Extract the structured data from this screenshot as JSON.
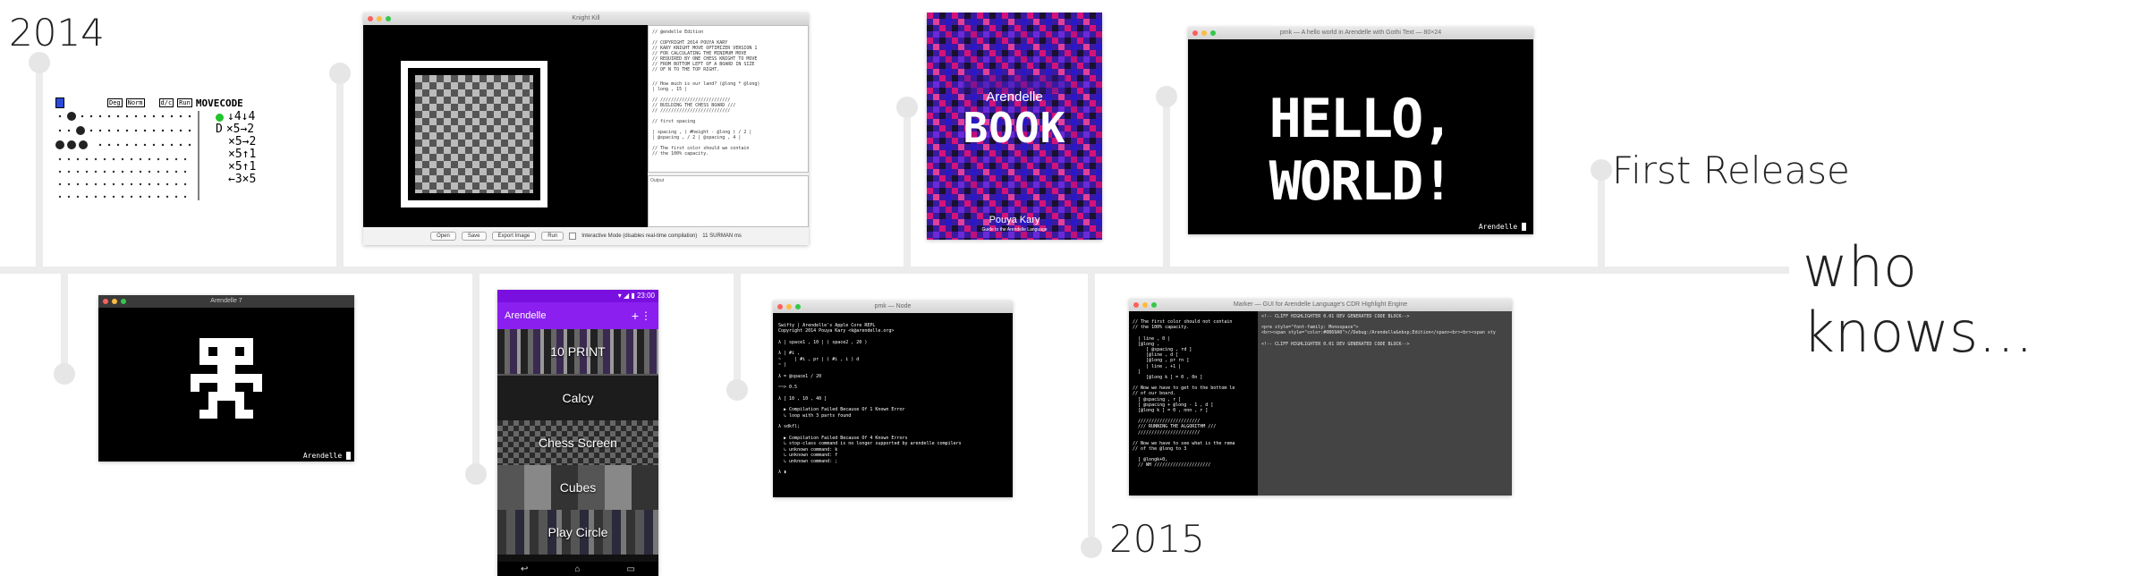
{
  "timeline": {
    "labels": {
      "y2014": "2014",
      "y2015": "2015",
      "first_release": "First Release",
      "who_knows": "who knows…"
    }
  },
  "shots": {
    "movecode": {
      "header": "MOVECODE",
      "btn_deg": "Deg",
      "btn_norm": "Norm",
      "btn_dc": "d/c",
      "btn_run": "Run",
      "cmds": [
        "↓4↓4",
        "×5→2",
        "×5→2",
        "×5↑1",
        "×5↑1",
        "←3×5"
      ],
      "side_letter": "D"
    },
    "knight": {
      "title": "Knight Kill",
      "code_lines": [
        "// @endelle Edition",
        "",
        "// COPYRIGHT 2014 POUYA KARY",
        "// KARY KNIGHT MOVE OPTIMIZER VERSION 1",
        "// FOR CALCULATING THE MINIMUM MOVE",
        "// REQUIRED BY ONE CHESS KNIGHT TO MOVE",
        "// FROM BOTTOM LEFT OF A BOARD IN SIZE",
        "// OF N TO THE TOP RIGHT.",
        "",
        "",
        "// How much is our land? (@long * @long)",
        "  | long , 15 |",
        "",
        "// //////////////////////////",
        "// BUILDING THE CHESS BOARD ///",
        "// //////////////////////////",
        "",
        "// first spacing",
        "",
        "  | spacing , ( #height - @long ) / 2 |",
        "  | @spacing , / 2 | @spacing , 4 |",
        "",
        "// The first color should we contain",
        "// the 100% capacity."
      ],
      "output_label": "Output",
      "buttons": [
        "Open",
        "Save",
        "Export Image",
        "Run"
      ],
      "checkbox_label": "Interactive Mode (disables real-time compilation)",
      "status": "11 SURMAN ms"
    },
    "book": {
      "brand": "Arendelle",
      "title": "BOOK",
      "author": "Pouya Kary",
      "subtitle": "Guide to the Arendelle Language"
    },
    "hello": {
      "title": "pmk — A hello world in Arendelle with Gothi Text — 80×24",
      "text": "HELLO, WORLD!",
      "footer": "Arendelle"
    },
    "robot": {
      "title": "Arendelle 7",
      "footer": "Arendelle"
    },
    "android": {
      "time": "23:00",
      "app_title": "Arendelle",
      "items": [
        "10 PRINT",
        "Calcy",
        "Chess Screen",
        "Cubes",
        "Play Circle"
      ]
    },
    "repl": {
      "title": "pmk — Node",
      "lines": [
        "Swifty | Arendelle's Apple Core REPL",
        "Copyright 2014 Pouya Kary <k@arendelle.org>",
        "",
        "λ | space1 , 10 | ( space2 , 20 )",
        "",
        "λ | #i ,",
        "~     | #i , pr | ( #i , i ) d",
        "~ |",
        "",
        "λ = @space1 / 20",
        "",
        "~~> 0.5",
        "",
        "λ [ 10 , 10 , 40 ]",
        "",
        "  ▶ Compilation Failed Because Of 1 Known Error",
        "  ↳ loop with 3 parts found",
        "",
        "λ sdkfl;",
        "",
        "  ▶ Compilation Failed Because Of 4 Known Errors",
        "  ↳ stop-class command is no longer supported by arendelle compilers",
        "  ↳ unknown command: k",
        "  ↳ unknown command: f",
        "  ↳ unknown command: ;",
        "",
        "λ ▮"
      ]
    },
    "marker": {
      "title": "Marker — GUI for Arendelle Language's CDR Highlight Engine",
      "left_lines": [
        "// The first color should not contain",
        "// the 100% capacity.",
        "",
        "  | line , 0 |",
        "  [@long ,",
        "     [ @spacing , rd ]",
        "     [@line , d ]",
        "     [@long , pr rn ]",
        "     | line , +1 |",
        "  ]",
        "     [@long k ] = 0 , 0n ]",
        "",
        "// Now we have to get to the bottom le",
        "// of our board.",
        "  [ @spacing , r ]",
        "  [ @spacing + @long - 1 , d ]",
        "  [@long k ] = 0 , nnn , r ]",
        "",
        "  ///////////////////////",
        "  /// RUNNING THE ALGORITHM ///",
        "  ///////////////////////",
        "",
        "// Now we have to see what is the rema",
        "// of the @long to 3",
        "",
        "  [ @longk+0,",
        "  // WH /////////////////////"
      ],
      "right_lines": [
        "<!-- CLIFF HIGHLIGHTER 0.01 DEV GENERATED CODE BLOCK-->",
        "",
        "<pre style=\"font-family: Monospace\">",
        "<br><span style=\"color:#0B69A0\">//Debug:/Arendelle&nbsp;Edition</span><br><br><span sty",
        "",
        "<!-- CLIFF HIGHLIGHTER 0.01 DEV GENERATED CODE BLOCK-->"
      ]
    }
  },
  "colors": {
    "timeline": "#ececec",
    "dot": "#e6e6e6",
    "android_purple": "#8a1ff0",
    "book_magenta": "#d4137a",
    "book_purple": "#4a1fb4"
  }
}
